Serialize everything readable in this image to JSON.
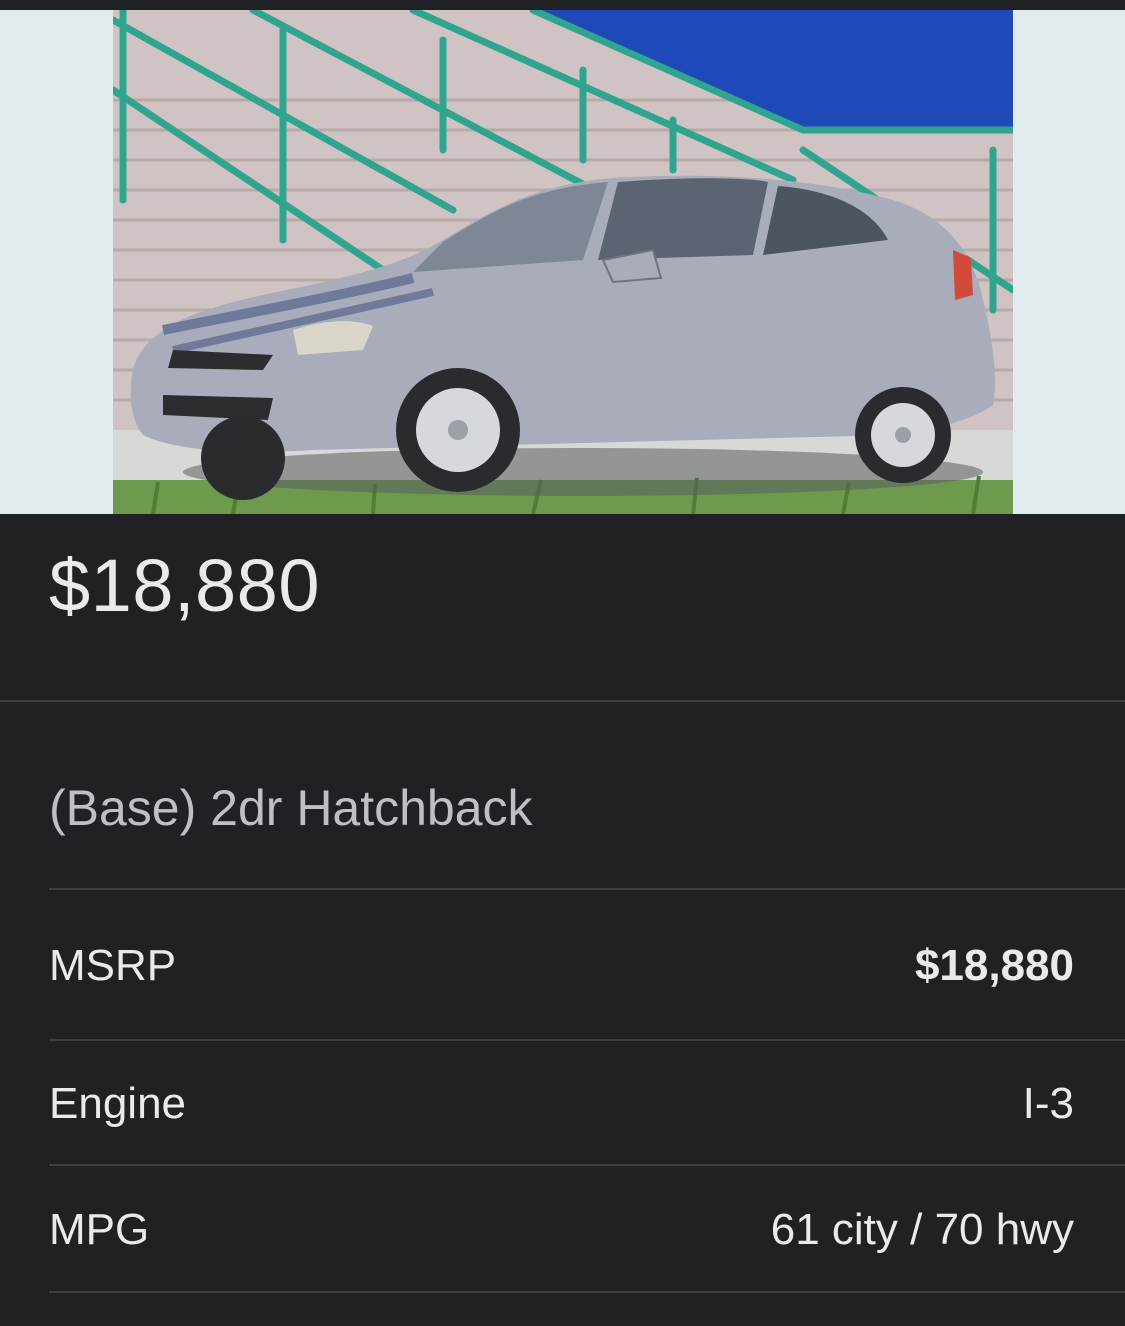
{
  "listing": {
    "price": "$18,880",
    "trim": "(Base) 2dr Hatchback"
  },
  "specs": [
    {
      "label": "MSRP",
      "value": "$18,880"
    },
    {
      "label": "Engine",
      "value": "I-3"
    },
    {
      "label": "MPG",
      "value": "61 city / 70 hwy"
    }
  ],
  "colors": {
    "background": "#202124",
    "divider": "#3c4043",
    "image_backdrop": "#e2ebee",
    "car_body": "#a9adbb",
    "railing": "#2fa58f",
    "sky_wall": "#1f48b8"
  }
}
